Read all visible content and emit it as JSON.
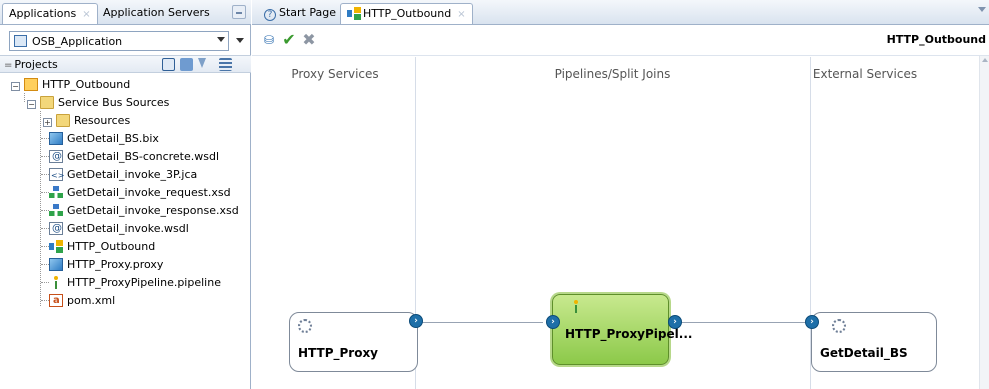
{
  "left_panel": {
    "tabs": [
      {
        "label": "Applications",
        "close": "×"
      },
      {
        "label": "Application Servers"
      }
    ],
    "app_select": {
      "value": "OSB_Application"
    },
    "projects_label": "Projects",
    "tree": {
      "root": "HTTP_Outbound",
      "folder": "Service Bus Sources",
      "resources": "Resources",
      "files": [
        {
          "label": "GetDetail_BS.bix",
          "icon": "business-service-icon"
        },
        {
          "label": "GetDetail_BS-concrete.wsdl",
          "icon": "wsdl-icon"
        },
        {
          "label": "GetDetail_invoke_3P.jca",
          "icon": "jca-icon"
        },
        {
          "label": "GetDetail_invoke_request.xsd",
          "icon": "xsd-icon"
        },
        {
          "label": "GetDetail_invoke_response.xsd",
          "icon": "xsd-icon"
        },
        {
          "label": "GetDetail_invoke.wsdl",
          "icon": "wsdl-icon"
        },
        {
          "label": "HTTP_Outbound",
          "icon": "composite-icon"
        },
        {
          "label": "HTTP_Proxy.proxy",
          "icon": "proxy-icon"
        },
        {
          "label": "HTTP_ProxyPipeline.pipeline",
          "icon": "pipeline-icon"
        },
        {
          "label": "pom.xml",
          "icon": "pom-icon"
        }
      ]
    }
  },
  "right_panel": {
    "tabs": [
      {
        "label": "Start Page"
      },
      {
        "label": "HTTP_Outbound",
        "close": "×"
      }
    ],
    "toolbar_title": "HTTP_Outbound",
    "columns": {
      "proxy": "Proxy Services",
      "pipelines": "Pipelines/Split Joins",
      "external": "External Services"
    },
    "nodes": {
      "proxy": "HTTP_Proxy",
      "pipeline": "HTTP_ProxyPipel...",
      "business": "GetDetail_BS"
    }
  },
  "colors": {
    "accent": "#1e6fa8",
    "pipeline_fill": "#a8d96a",
    "panel_border": "#9fb1c9"
  }
}
